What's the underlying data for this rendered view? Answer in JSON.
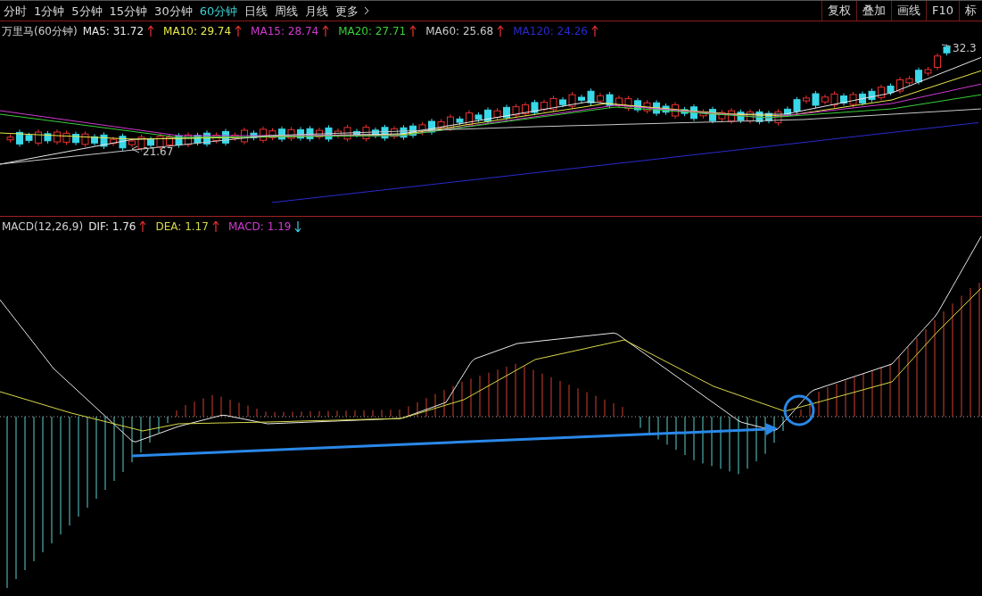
{
  "period_tabs": [
    {
      "label": "分时",
      "selected": false
    },
    {
      "label": "1分钟",
      "selected": false
    },
    {
      "label": "5分钟",
      "selected": false
    },
    {
      "label": "15分钟",
      "selected": false
    },
    {
      "label": "30分钟",
      "selected": false
    },
    {
      "label": "60分钟",
      "selected": true
    },
    {
      "label": "日线",
      "selected": false
    },
    {
      "label": "周线",
      "selected": false
    },
    {
      "label": "月线",
      "selected": false
    }
  ],
  "more_tab": {
    "label": "更多"
  },
  "tool_buttons": [
    "复权",
    "叠加",
    "画线",
    "F10",
    "标"
  ],
  "price_panel": {
    "title": "万里马(60分钟)",
    "indicators": [
      {
        "label": "MA5: 31.72",
        "color": "#e8e8e8",
        "rising": true
      },
      {
        "label": "MA10: 29.74",
        "color": "#e8e84a",
        "rising": true
      },
      {
        "label": "MA15: 28.74",
        "color": "#d03ad0",
        "rising": true
      },
      {
        "label": "MA20: 27.71",
        "color": "#3ad03a",
        "rising": true
      },
      {
        "label": "MA60: 25.68",
        "color": "#c8c8c8",
        "rising": true
      },
      {
        "label": "MA120: 24.26",
        "color": "#2a2ad0",
        "rising": true
      }
    ],
    "low_label": "21.67",
    "high_label": "32.3"
  },
  "macd_panel": {
    "title": "MACD(12,26,9)",
    "indicators": [
      {
        "label": "DIF: 1.76",
        "color": "#e8e8e8",
        "rising": true
      },
      {
        "label": "DEA: 1.17",
        "color": "#d8d84a",
        "rising": true
      },
      {
        "label": "MACD: 1.19",
        "color": "#d03ad0",
        "rising": false
      }
    ]
  }
}
